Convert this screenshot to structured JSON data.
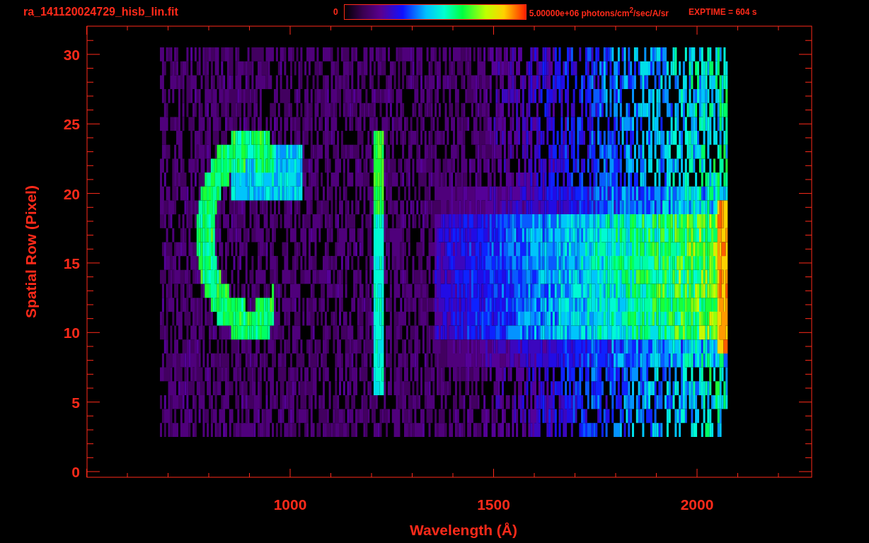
{
  "title": "ra_141120024729_hisb_lin.fit",
  "colorbar": {
    "min_label": "0",
    "max_label": "5.00000e+06 photons/cm$^{2}$/sec/A/sr"
  },
  "exptime": "EXPTIME = 604 s",
  "plot": {
    "xlabel": "Wavelength (Å)",
    "ylabel": "Spatial Row (Pixel)",
    "xtick_labels": [
      "1000",
      "1500",
      "2000"
    ],
    "ytick_labels": [
      "30",
      "25",
      "20",
      "15",
      "10",
      "5",
      "0"
    ]
  }
}
